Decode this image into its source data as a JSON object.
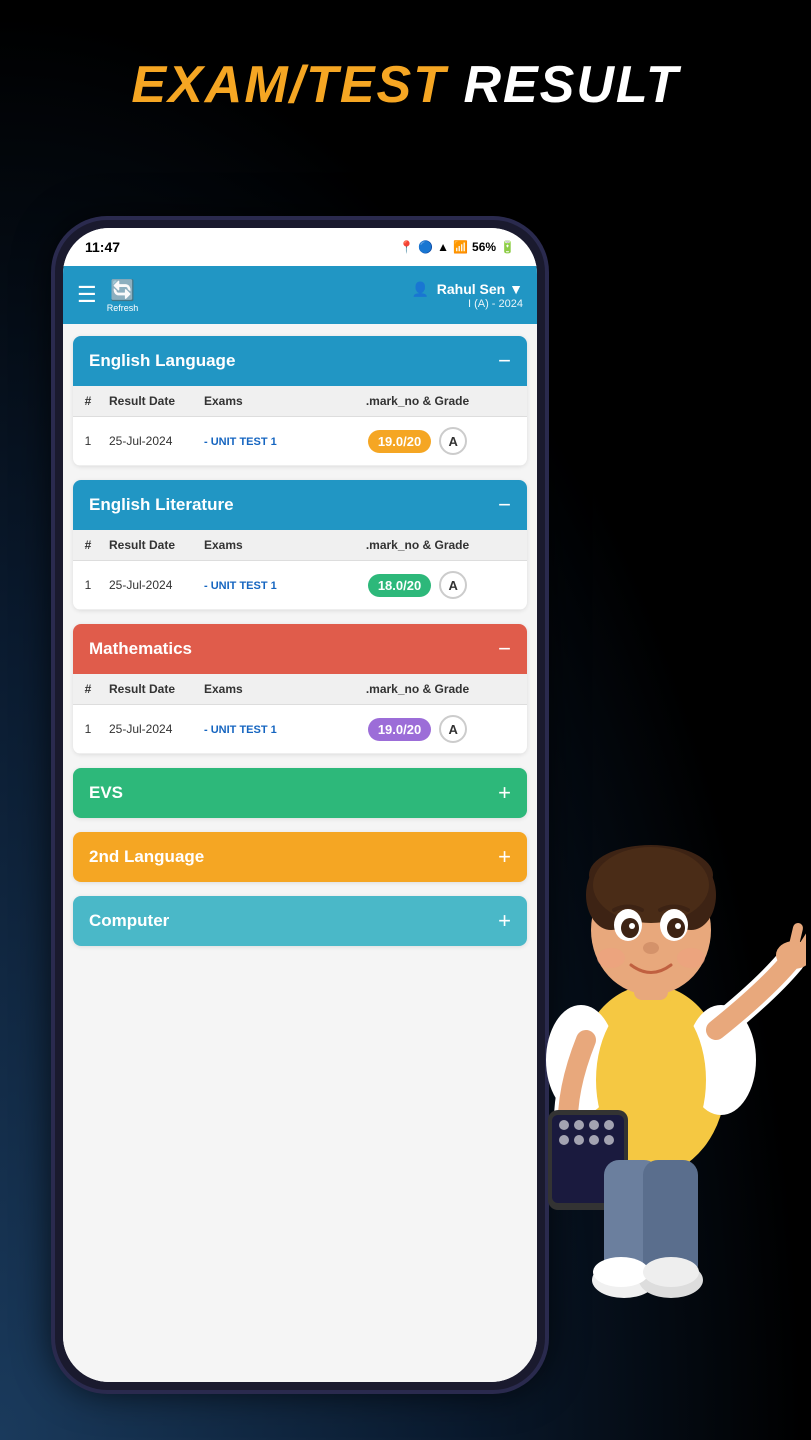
{
  "page": {
    "title_part1": "EXAM/TEST",
    "title_part2": "RESULT"
  },
  "status_bar": {
    "time": "11:47",
    "battery": "56%"
  },
  "header": {
    "user_name": "Rahul Sen",
    "class": "I (A) - 2024",
    "refresh_label": "Refresh"
  },
  "subjects": [
    {
      "id": "english-language",
      "name": "English Language",
      "color": "blue",
      "expanded": true,
      "collapse_icon": "−",
      "columns": [
        "#",
        "Result Date",
        "Exams",
        ".mark_no & Grade"
      ],
      "rows": [
        {
          "num": 1,
          "date": "25-Jul-2024",
          "exam": "- UNIT TEST 1",
          "marks": "19.0/20",
          "grade": "A",
          "marks_color": "orange-bg"
        }
      ]
    },
    {
      "id": "english-literature",
      "name": "English Literature",
      "color": "blue",
      "expanded": true,
      "collapse_icon": "−",
      "columns": [
        "#",
        "Result Date",
        "Exams",
        ".mark_no & Grade"
      ],
      "rows": [
        {
          "num": 1,
          "date": "25-Jul-2024",
          "exam": "- UNIT TEST 1",
          "marks": "18.0/20",
          "grade": "A",
          "marks_color": "green-bg"
        }
      ]
    },
    {
      "id": "mathematics",
      "name": "Mathematics",
      "color": "red",
      "expanded": true,
      "collapse_icon": "−",
      "columns": [
        "#",
        "Result Date",
        "Exams",
        ".mark_no & Grade"
      ],
      "rows": [
        {
          "num": 1,
          "date": "25-Jul-2024",
          "exam": "- UNIT TEST 1",
          "marks": "19.0/20",
          "grade": "A",
          "marks_color": "purple-bg"
        }
      ]
    }
  ],
  "collapsed_subjects": [
    {
      "id": "evs",
      "name": "EVS",
      "color": "green",
      "expand_icon": "+"
    },
    {
      "id": "2nd-language",
      "name": "2nd Language",
      "color": "orange",
      "expand_icon": "+"
    },
    {
      "id": "computer",
      "name": "Computer",
      "color": "teal",
      "expand_icon": "+"
    }
  ]
}
